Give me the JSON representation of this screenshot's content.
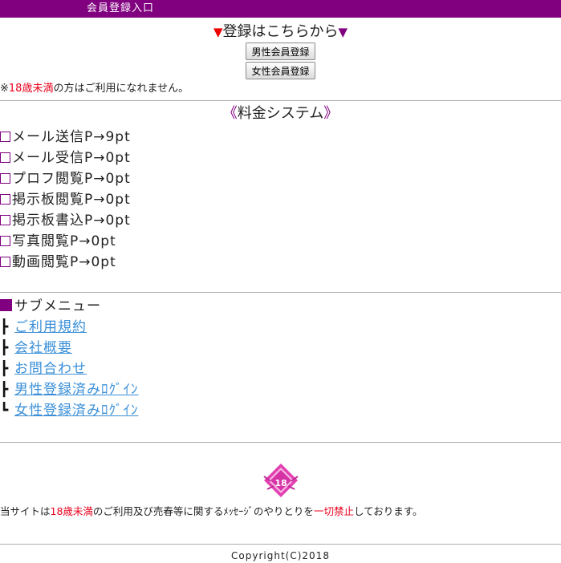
{
  "header": {
    "title": "会員登録入口"
  },
  "registration": {
    "heading": "登録はこちらから",
    "male_button": "男性会員登録",
    "female_button": "女性会員登録",
    "age_note_prefix": "※",
    "age_note_highlight": "18歳未満",
    "age_note_suffix": "の方はご利用になれません。"
  },
  "pricing": {
    "open_mark": "《",
    "title": "料金システム",
    "close_mark": "》",
    "items": [
      {
        "label": "メール送信P→9pt"
      },
      {
        "label": "メール受信P→0pt"
      },
      {
        "label": "プロフ閲覧P→0pt"
      },
      {
        "label": "掲示板閲覧P→0pt"
      },
      {
        "label": "掲示板書込P→0pt"
      },
      {
        "label": "写真閲覧P→0pt"
      },
      {
        "label": "動画閲覧P→0pt"
      }
    ]
  },
  "submenu": {
    "title": "サブメニュー",
    "items": [
      {
        "tree": "┣",
        "label": "ご利用規約"
      },
      {
        "tree": "┣",
        "label": "会社概要"
      },
      {
        "tree": "┣",
        "label": "お問合わせ"
      },
      {
        "tree": "┣",
        "label": "男性登録済みﾛｸﾞｲﾝ"
      },
      {
        "tree": "┗",
        "label": "女性登録済みﾛｸﾞｲﾝ"
      }
    ]
  },
  "footer": {
    "badge_text": "18",
    "disclaimer_1": "当サイトは",
    "disclaimer_highlight_1": "18歳未満",
    "disclaimer_2": "のご利用及び売春等に関するﾒｯｾｰｼﾞのやりとりを",
    "disclaimer_highlight_2": "一切禁止",
    "disclaimer_3": "しております。",
    "copyright": "Copyright(C)2018"
  },
  "colors": {
    "brand_purple": "#800080",
    "warning_red": "#e8001c",
    "link_blue": "#3a8fd8"
  }
}
